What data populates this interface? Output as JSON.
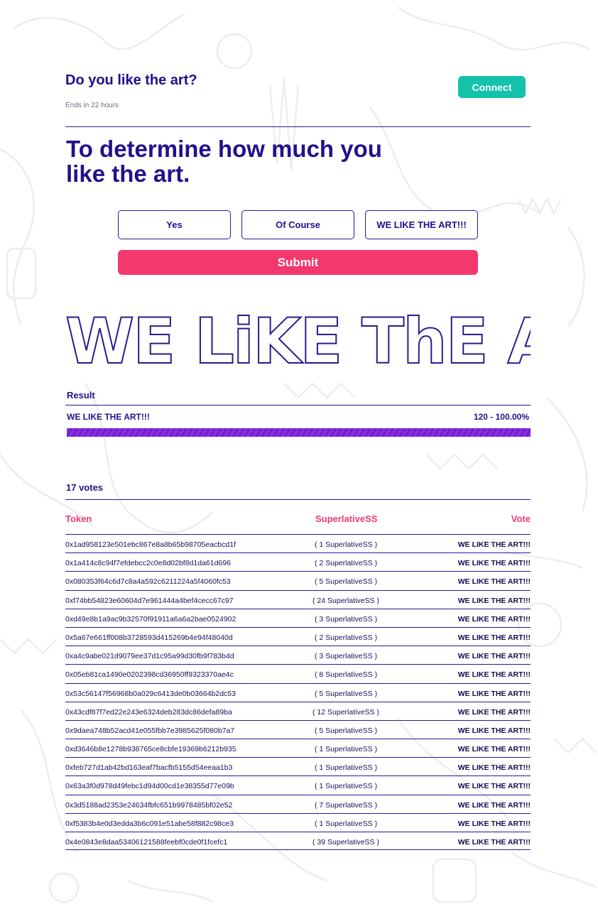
{
  "header": {
    "title": "Do you like the art?",
    "ends_text": "Ends in 22 hours",
    "connect_label": "Connect"
  },
  "proposal": {
    "question": "To determine how much you like the art."
  },
  "choices": [
    "Yes",
    "Of Course",
    "WE LIKE THE ART!!!"
  ],
  "submit_label": "Submit",
  "banner_text": "WE LiKE ThE ART",
  "result": {
    "label": "Result",
    "choice": "WE LIKE THE ART!!!",
    "summary": "120 - 100.00%",
    "percent": 100
  },
  "votes": {
    "count_text": "17 votes",
    "columns": [
      "Token",
      "SuperlativeSS",
      "Vote"
    ],
    "rows": [
      {
        "token": "0x1ad958123e501ebc867e8a8b65b98705eacbcd1f",
        "amount": "( 1 SuperlativeSS )",
        "vote": "WE LIKE THE ART!!!"
      },
      {
        "token": "0x1a414c8c94f7efdebcc2c0e8d02bf8d1da61d696",
        "amount": "( 2 SuperlativeSS )",
        "vote": "WE LIKE THE ART!!!"
      },
      {
        "token": "0x080353f64c6d7c8a4a592c6211224a5f4060fc53",
        "amount": "( 5 SuperlativeSS )",
        "vote": "WE LIKE THE ART!!!"
      },
      {
        "token": "0xf74bb54823e60604d7e961444a4bef4cecc67c97",
        "amount": "( 24 SuperlativeSS )",
        "vote": "WE LIKE THE ART!!!"
      },
      {
        "token": "0xd49e8b1a9ac9b32570f91911a6a6a2bae0524902",
        "amount": "( 3 SuperlativeSS )",
        "vote": "WE LIKE THE ART!!!"
      },
      {
        "token": "0x5a67e661ff008b3728593d415269b4e94f48040d",
        "amount": "( 2 SuperlativeSS )",
        "vote": "WE LIKE THE ART!!!"
      },
      {
        "token": "0xa4c9abe021d9079ee37d1c95a99d30fb9f783b4d",
        "amount": "( 3 SuperlativeSS )",
        "vote": "WE LIKE THE ART!!!"
      },
      {
        "token": "0x05eb81ca1490e0202398cd36950ff9323370ae4c",
        "amount": "( 8 SuperlativeSS )",
        "vote": "WE LIKE THE ART!!!"
      },
      {
        "token": "0x53c56147f56968b0a029c6413de0b03664b2dc53",
        "amount": "( 5 SuperlativeSS )",
        "vote": "WE LIKE THE ART!!!"
      },
      {
        "token": "0x43cdf87f7ed22e243e6324deb283dc86defa89ba",
        "amount": "( 12 SuperlativeSS )",
        "vote": "WE LIKE THE ART!!!"
      },
      {
        "token": "0x9daea748b52acd41e055fbb7e3985625f080b7a7",
        "amount": "( 5 SuperlativeSS )",
        "vote": "WE LIKE THE ART!!!"
      },
      {
        "token": "0xd3646b8e1278b938765ce8cbfe19369b6212b935",
        "amount": "( 1 SuperlativeSS )",
        "vote": "WE LIKE THE ART!!!"
      },
      {
        "token": "0xfeb727d1ab42bd163eaf7bacfb5155d54eeaa1b3",
        "amount": "( 1 SuperlativeSS )",
        "vote": "WE LIKE THE ART!!!"
      },
      {
        "token": "0x63a3f0d978d49febc1d94d00cd1e38355d77e09b",
        "amount": "( 1 SuperlativeSS )",
        "vote": "WE LIKE THE ART!!!"
      },
      {
        "token": "0x3d5188ad2353e24634fbfc651b9978485bf02e52",
        "amount": "( 7 SuperlativeSS )",
        "vote": "WE LIKE THE ART!!!"
      },
      {
        "token": "0xf5383b4e0d3edda3b6c091e51abe58f882c98ce3",
        "amount": "( 1 SuperlativeSS )",
        "vote": "WE LIKE THE ART!!!"
      },
      {
        "token": "0x4e0843e8daa53406121588feebf0cde0f1fcefc1",
        "amount": "( 39 SuperlativeSS )",
        "vote": "WE LIKE THE ART!!!"
      }
    ]
  }
}
